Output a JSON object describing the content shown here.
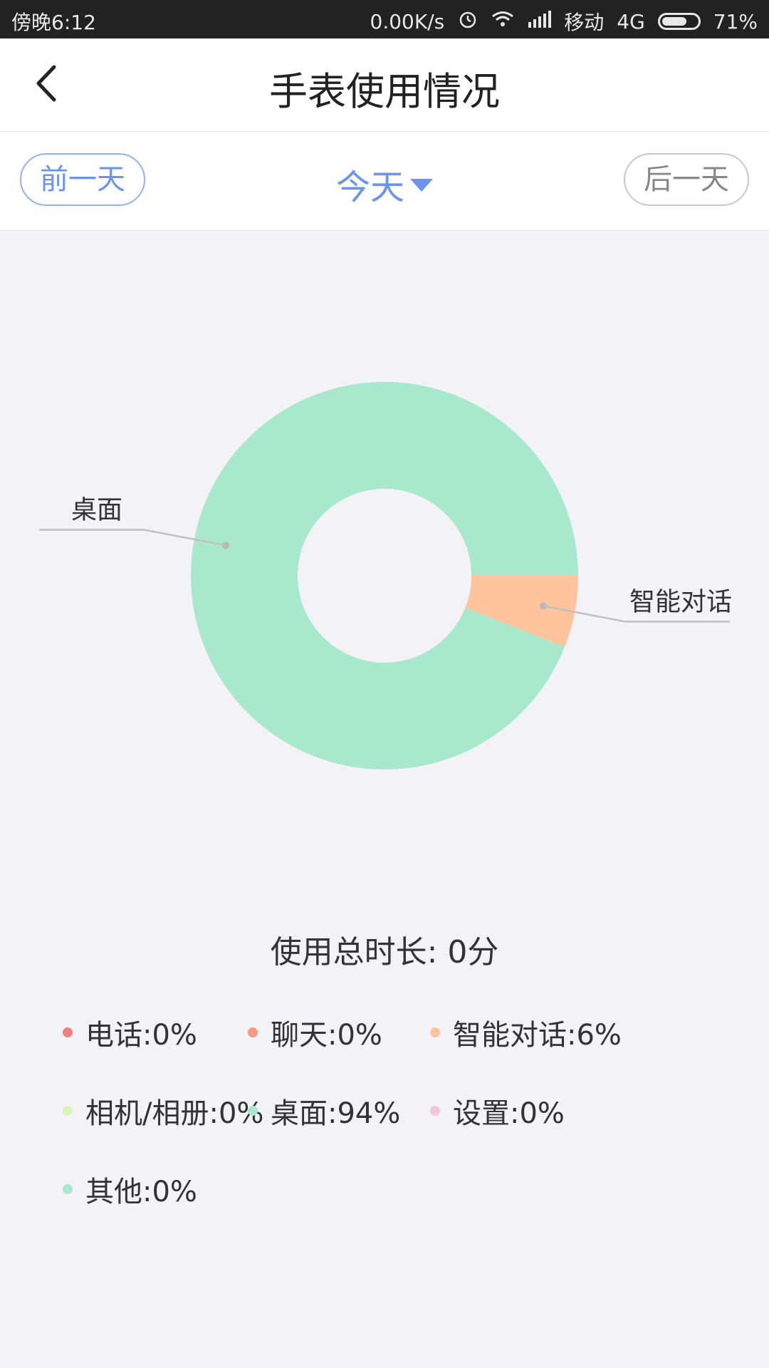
{
  "status_bar": {
    "time": "傍晚6:12",
    "net_speed": "0.00K/s",
    "carrier": "移动",
    "network": "4G",
    "battery": "71%",
    "battery_level": 0.71,
    "icons": [
      "alarm-icon",
      "wifi-icon",
      "signal-icon",
      "battery-icon"
    ]
  },
  "header": {
    "title": "手表使用情况",
    "back_icon": "chevron-left-icon"
  },
  "date_nav": {
    "prev_label": "前一天",
    "current_label": "今天",
    "next_label": "后一天",
    "caret_icon": "caret-down-icon"
  },
  "chart_data": {
    "type": "pie",
    "categories": [
      "电话",
      "聊天",
      "智能对话",
      "相机/相册",
      "桌面",
      "设置",
      "其他"
    ],
    "values": [
      0,
      0,
      6,
      0,
      94,
      0,
      0
    ],
    "colors": [
      "#f08080",
      "#f59a84",
      "#ffc49b",
      "#d9f5b8",
      "#a8e9cd",
      "#f6c3e0",
      "#a8e9cd"
    ],
    "donut": true,
    "callout_labels": [
      "桌面",
      "智能对话"
    ]
  },
  "summary": {
    "total_label": "使用总时长",
    "total_value": "0分"
  },
  "legend": [
    {
      "label": "电话:0%",
      "color": "#f08080"
    },
    {
      "label": "聊天:0%",
      "color": "#f59a84"
    },
    {
      "label": "智能对话:6%",
      "color": "#ffc49b"
    },
    {
      "label": "相机/相册:0%",
      "color": "#d9f5b8"
    },
    {
      "label": "桌面:94%",
      "color": "#a8e9cd"
    },
    {
      "label": "设置:0%",
      "color": "#f6c3e0"
    },
    {
      "label": "其他:0%",
      "color": "#a8e9cd"
    }
  ]
}
